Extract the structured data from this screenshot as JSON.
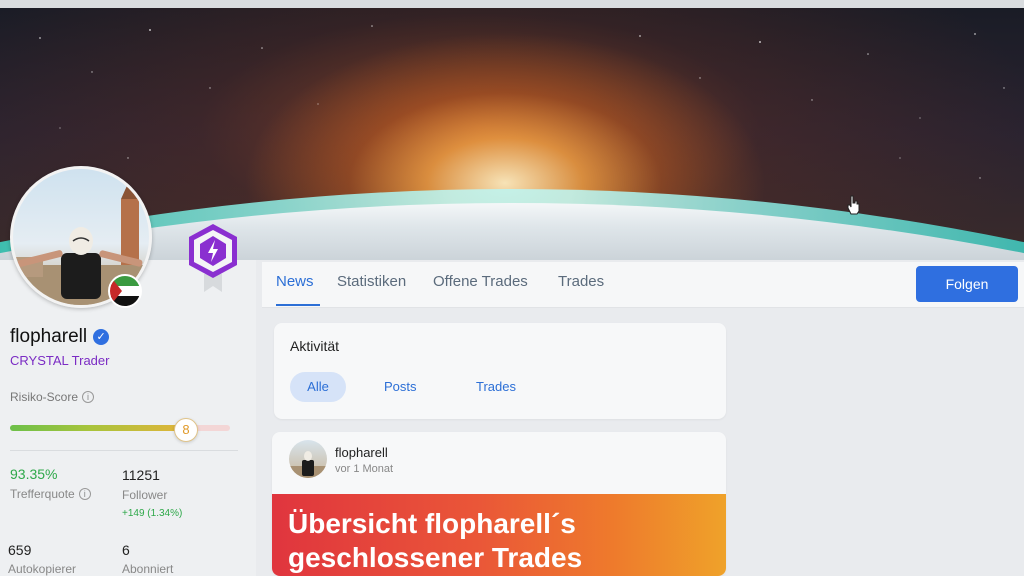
{
  "profile": {
    "username": "flopharell",
    "tier": "CRYSTAL Trader",
    "risk_label": "Risiko-Score",
    "risk_score": "8",
    "risk_fraction": 0.8
  },
  "stats": {
    "hit_rate": {
      "value": "93.35%",
      "label": "Trefferquote"
    },
    "followers": {
      "value": "11251",
      "label": "Follower",
      "delta": "+149 (1.34%)"
    },
    "copiers": {
      "value": "659",
      "label": "Autokopierer"
    },
    "subscribed": {
      "value": "6",
      "label": "Abonniert"
    }
  },
  "tabs": [
    {
      "label": "News",
      "active": true
    },
    {
      "label": "Statistiken"
    },
    {
      "label": "Offene Trades"
    },
    {
      "label": "Trades"
    }
  ],
  "follow_label": "Folgen",
  "activity": {
    "title": "Aktivität",
    "filters": [
      {
        "label": "Alle",
        "active": true
      },
      {
        "label": "Posts"
      },
      {
        "label": "Trades"
      }
    ]
  },
  "post": {
    "author": "flopharell",
    "time": "vor 1 Monat",
    "banner_line1": "Übersicht flopharell´s",
    "banner_line2": "geschlossener Trades"
  },
  "colors": {
    "accent": "#2f6fe0",
    "tier": "#7b2cc4",
    "positive": "#2ea84a",
    "banner_start": "#e0353e",
    "banner_end": "#efa22a"
  }
}
